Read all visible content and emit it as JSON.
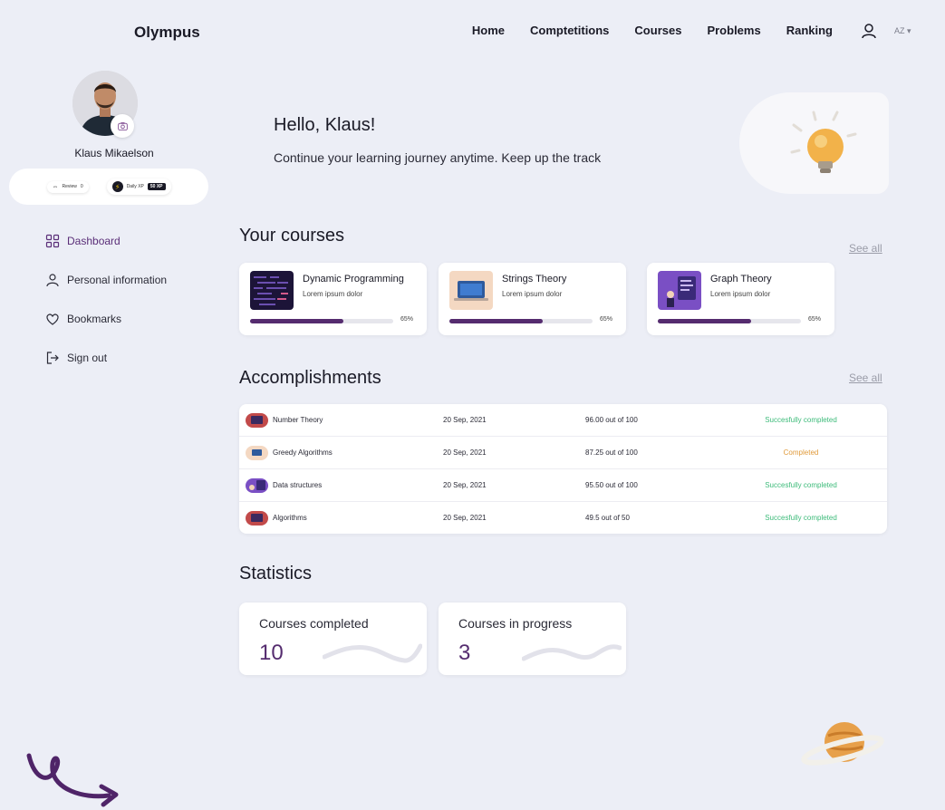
{
  "header": {
    "logo": "Olympus",
    "nav": [
      "Home",
      "Comptetitions",
      "Courses",
      "Problems",
      "Ranking"
    ],
    "lang": "AZ ▾"
  },
  "profile": {
    "name": "Klaus Mikaelson",
    "review_label": "Review",
    "review_value": "0",
    "daily_label": "Daily XP",
    "daily_xp": "50 XP"
  },
  "sidebar": {
    "items": [
      {
        "label": "Dashboard",
        "icon": "grid-icon"
      },
      {
        "label": "Personal information",
        "icon": "person-icon"
      },
      {
        "label": "Bookmarks",
        "icon": "heart-icon"
      },
      {
        "label": "Sign out",
        "icon": "signout-icon"
      }
    ]
  },
  "hero": {
    "greeting": "Hello, Klaus!",
    "subtitle": "Continue your learning journey anytime. Keep up the track"
  },
  "courses": {
    "title": "Your courses",
    "see_all": "See all",
    "items": [
      {
        "title": "Dynamic Programming",
        "subtitle": "Lorem ipsum dolor",
        "progress": 0.65,
        "progress_label": "65%"
      },
      {
        "title": "Strings Theory",
        "subtitle": "Lorem ipsum dolor",
        "progress": 0.65,
        "progress_label": "65%"
      },
      {
        "title": "Graph Theory",
        "subtitle": "Lorem ipsum dolor",
        "progress": 0.65,
        "progress_label": "65%"
      }
    ]
  },
  "accomplishments": {
    "title": "Accomplishments",
    "see_all": "See all",
    "rows": [
      {
        "name": "Number Theory",
        "date": "20 Sep, 2021",
        "score": "96.00 out of 100",
        "status": "Succesfully completed",
        "status_color": "#3dbb7a"
      },
      {
        "name": "Greedy Algorithms",
        "date": "20 Sep, 2021",
        "score": "87.25 out of 100",
        "status": "Completed",
        "status_color": "#e09a3a"
      },
      {
        "name": "Data structures",
        "date": "20 Sep, 2021",
        "score": "95.50 out of 100",
        "status": "Succesfully completed",
        "status_color": "#3dbb7a"
      },
      {
        "name": "Algorithms",
        "date": "20 Sep, 2021",
        "score": "49.5 out of 50",
        "status": "Succesfully completed",
        "status_color": "#3dbb7a"
      }
    ]
  },
  "statistics": {
    "title": "Statistics",
    "items": [
      {
        "label": "Courses completed",
        "value": "10"
      },
      {
        "label": "Courses in progress",
        "value": "3"
      }
    ]
  },
  "colors": {
    "accent": "#552c6f",
    "success": "#3dbb7a",
    "warning": "#e09a3a",
    "background": "#eceef6"
  }
}
